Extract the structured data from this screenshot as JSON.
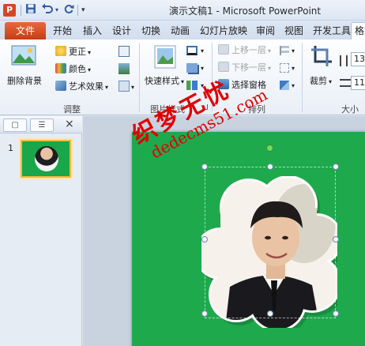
{
  "window": {
    "app_icon": "P",
    "title": "演示文稿1 - Microsoft PowerPoint"
  },
  "qat": {
    "save_icon": "save-icon",
    "undo_icon": "undo-icon",
    "redo_icon": "redo-icon",
    "customize_icon": "customize-qat-icon"
  },
  "tabs": {
    "file": "文件",
    "items": [
      "开始",
      "插入",
      "设计",
      "切换",
      "动画",
      "幻灯片放映",
      "审阅",
      "视图",
      "开发工具",
      "格式"
    ],
    "active": "格式"
  },
  "ribbon": {
    "adjust": {
      "remove_bg": "删除背景",
      "corrections": "更正",
      "color": "颜色",
      "artistic": "艺术效果",
      "label": "调整"
    },
    "picture_styles": {
      "quick_styles": "快速样式",
      "label": "图片样式"
    },
    "arrange": {
      "bring_forward": "上移一层",
      "send_backward": "下移一层",
      "selection_pane": "选择窗格",
      "label": "排列"
    },
    "size": {
      "crop": "裁剪",
      "height": "13",
      "width": "11",
      "label": "大小"
    }
  },
  "slides_panel": {
    "slide_number": "1",
    "close_icon": "×"
  },
  "watermark": {
    "text_cn": "织梦无忧",
    "text_url": "dedecms51.com"
  },
  "colors": {
    "slide_bg": "#1fa94d",
    "file_tab": "#d24726",
    "watermark": "#e00000"
  }
}
